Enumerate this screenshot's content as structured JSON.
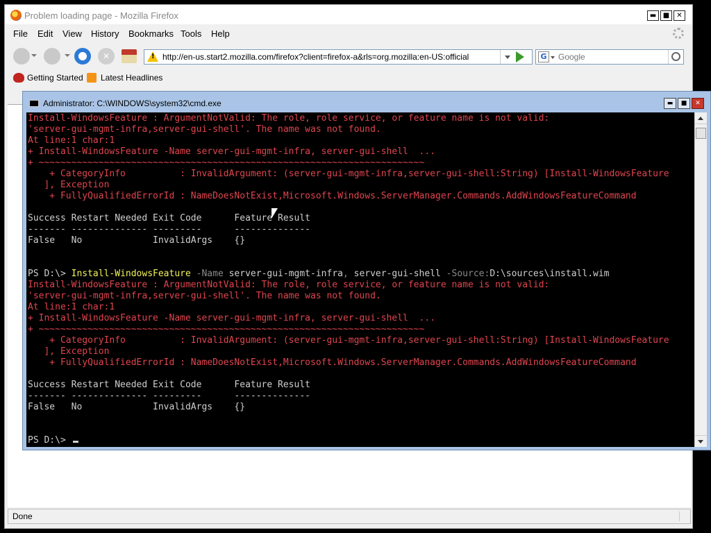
{
  "firefox": {
    "title": "Problem loading page - Mozilla Firefox",
    "window_buttons": {
      "minimize": "▬",
      "maximize": "■",
      "close": "✕"
    },
    "menu": [
      {
        "label": "File"
      },
      {
        "label": "Edit"
      },
      {
        "label": "View"
      },
      {
        "label": "History"
      },
      {
        "label": "Bookmarks"
      },
      {
        "label": "Tools"
      },
      {
        "label": "Help"
      }
    ],
    "url": "http://en-us.start2.mozilla.com/firefox?client=firefox-a&rls=org.mozilla:en-US:official",
    "search": {
      "engine_letter": "G",
      "placeholder": "Google"
    },
    "bookmarks": [
      {
        "label": "Getting Started"
      },
      {
        "label": "Latest Headlines"
      }
    ],
    "status": "Done"
  },
  "cmd": {
    "title": "Administrator: C:\\WINDOWS\\system32\\cmd.exe",
    "window_buttons": {
      "minimize": "▬",
      "maximize": "■",
      "close": "✕"
    },
    "lines": [
      {
        "segs": [
          {
            "t": "Install-WindowsFeature : ArgumentNotValid: The role, role service, or feature name is not valid:",
            "c": "red"
          }
        ]
      },
      {
        "segs": [
          {
            "t": "'server-gui-mgmt-infra,server-gui-shell'. The name was not found.",
            "c": "red"
          }
        ]
      },
      {
        "segs": [
          {
            "t": "At line:1 char:1",
            "c": "red"
          }
        ]
      },
      {
        "segs": [
          {
            "t": "+ Install-WindowsFeature -Name server-gui-mgmt-infra, server-gui-shell  ...",
            "c": "red"
          }
        ]
      },
      {
        "segs": [
          {
            "t": "+ ~~~~~~~~~~~~~~~~~~~~~~~~~~~~~~~~~~~~~~~~~~~~~~~~~~~~~~~~~~~~~~~~~~~~~~~",
            "c": "red"
          }
        ]
      },
      {
        "segs": [
          {
            "t": "    + CategoryInfo          : InvalidArgument: (server-gui-mgmt-infra,server-gui-shell:String) [Install-WindowsFeature",
            "c": "red"
          }
        ]
      },
      {
        "segs": [
          {
            "t": "   ], Exception",
            "c": "red"
          }
        ]
      },
      {
        "segs": [
          {
            "t": "    + FullyQualifiedErrorId : NameDoesNotExist,Microsoft.Windows.ServerManager.Commands.AddWindowsFeatureCommand",
            "c": "red"
          }
        ]
      },
      {
        "segs": [
          {
            "t": "",
            "c": "white"
          }
        ]
      },
      {
        "segs": [
          {
            "t": "Success Restart Needed Exit Code      Feature Result",
            "c": "white"
          }
        ]
      },
      {
        "segs": [
          {
            "t": "------- -------------- ---------      --------------",
            "c": "white"
          }
        ]
      },
      {
        "segs": [
          {
            "t": "False   No             InvalidArgs    {}",
            "c": "white"
          }
        ]
      },
      {
        "segs": [
          {
            "t": "",
            "c": "white"
          }
        ]
      },
      {
        "segs": [
          {
            "t": "",
            "c": "white"
          }
        ]
      },
      {
        "segs": [
          {
            "t": "PS D:\\> ",
            "c": "white"
          },
          {
            "t": "Install-WindowsFeature",
            "c": "yellow"
          },
          {
            "t": " -Name",
            "c": "gray"
          },
          {
            "t": " server-gui-mgmt-infra",
            "c": "white"
          },
          {
            "t": ",",
            "c": "gray"
          },
          {
            "t": " server-gui-shell",
            "c": "white"
          },
          {
            "t": " -Source:",
            "c": "gray"
          },
          {
            "t": "D:\\sources\\install.wim",
            "c": "white"
          }
        ]
      },
      {
        "segs": [
          {
            "t": "Install-WindowsFeature : ArgumentNotValid: The role, role service, or feature name is not valid:",
            "c": "red"
          }
        ]
      },
      {
        "segs": [
          {
            "t": "'server-gui-mgmt-infra,server-gui-shell'. The name was not found.",
            "c": "red"
          }
        ]
      },
      {
        "segs": [
          {
            "t": "At line:1 char:1",
            "c": "red"
          }
        ]
      },
      {
        "segs": [
          {
            "t": "+ Install-WindowsFeature -Name server-gui-mgmt-infra, server-gui-shell  ...",
            "c": "red"
          }
        ]
      },
      {
        "segs": [
          {
            "t": "+ ~~~~~~~~~~~~~~~~~~~~~~~~~~~~~~~~~~~~~~~~~~~~~~~~~~~~~~~~~~~~~~~~~~~~~~~",
            "c": "red"
          }
        ]
      },
      {
        "segs": [
          {
            "t": "    + CategoryInfo          : InvalidArgument: (server-gui-mgmt-infra,server-gui-shell:String) [Install-WindowsFeature",
            "c": "red"
          }
        ]
      },
      {
        "segs": [
          {
            "t": "   ], Exception",
            "c": "red"
          }
        ]
      },
      {
        "segs": [
          {
            "t": "    + FullyQualifiedErrorId : NameDoesNotExist,Microsoft.Windows.ServerManager.Commands.AddWindowsFeatureCommand",
            "c": "red"
          }
        ]
      },
      {
        "segs": [
          {
            "t": "",
            "c": "white"
          }
        ]
      },
      {
        "segs": [
          {
            "t": "Success Restart Needed Exit Code      Feature Result",
            "c": "white"
          }
        ]
      },
      {
        "segs": [
          {
            "t": "------- -------------- ---------      --------------",
            "c": "white"
          }
        ]
      },
      {
        "segs": [
          {
            "t": "False   No             InvalidArgs    {}",
            "c": "white"
          }
        ]
      },
      {
        "segs": [
          {
            "t": "",
            "c": "white"
          }
        ]
      },
      {
        "segs": [
          {
            "t": "",
            "c": "white"
          }
        ]
      },
      {
        "segs": [
          {
            "t": "PS D:\\> ",
            "c": "white"
          }
        ],
        "cursor": true
      }
    ]
  },
  "colors": {
    "error": "#e0454f",
    "text": "#cfcfcf",
    "command": "#f2f25a",
    "param": "#8a8a8a",
    "console_bg": "#000000",
    "cmd_frame": "#a9c4e6"
  }
}
